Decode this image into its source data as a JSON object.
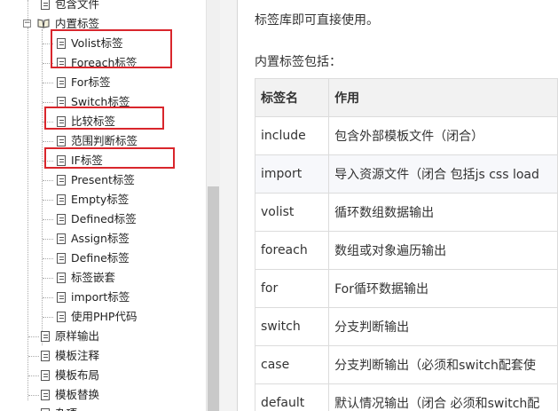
{
  "tree": {
    "top_item": "包含文件",
    "folder_label": "内置标签",
    "children": [
      "Volist标签",
      "Foreach标签",
      "For标签",
      "Switch标签",
      "比较标签",
      "范围判断标签",
      "IF标签",
      "Present标签",
      "Empty标签",
      "Defined标签",
      "Assign标签",
      "Define标签",
      "标签嵌套",
      "import标签",
      "使用PHP代码"
    ],
    "siblings": [
      "原样输出",
      "模板注释",
      "模板布局",
      "模板替换"
    ],
    "bottom_partial": "杂项",
    "highlight_color": "#d9262c"
  },
  "content": {
    "intro": "标签库即可直接使用。",
    "list_title": "内置标签包括：",
    "table": {
      "headers": [
        "标签名",
        "作用"
      ],
      "rows": [
        [
          "include",
          "包含外部模板文件（闭合）"
        ],
        [
          "import",
          "导入资源文件（闭合 包括js css load"
        ],
        [
          "volist",
          "循环数组数据输出"
        ],
        [
          "foreach",
          "数组或对象遍历输出"
        ],
        [
          "for",
          "For循环数据输出"
        ],
        [
          "switch",
          "分支判断输出"
        ],
        [
          "case",
          "分支判断输出（必须和switch配套使"
        ],
        [
          "default",
          "默认情况输出（闭合 必须和switch配"
        ]
      ]
    }
  }
}
